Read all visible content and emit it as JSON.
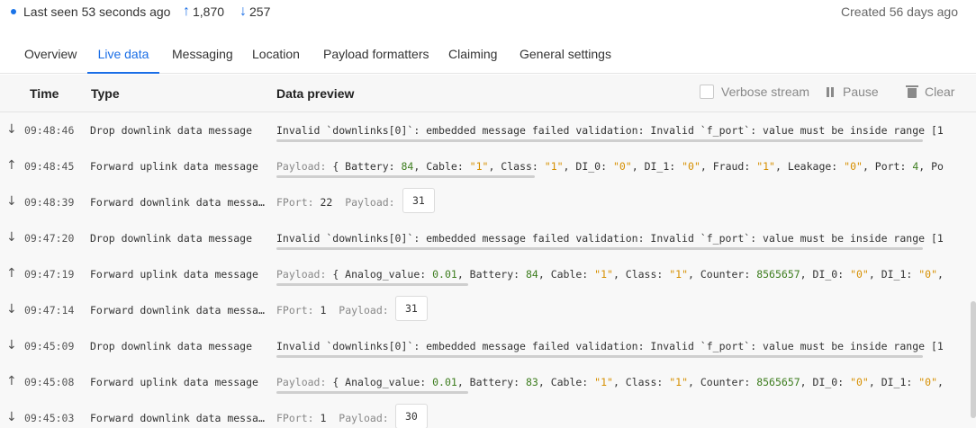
{
  "header": {
    "last_seen": "Last seen 53 seconds ago",
    "uplink_count": "1,870",
    "downlink_count": "257",
    "created": "Created 56 days ago"
  },
  "tabs": [
    "Overview",
    "Live data",
    "Messaging",
    "Location",
    "Payload formatters",
    "Claiming",
    "General settings"
  ],
  "active_tab": "Live data",
  "table": {
    "col_time": "Time",
    "col_type": "Type",
    "col_preview": "Data preview",
    "verbose_label": "Verbose stream",
    "pause_label": "Pause",
    "clear_label": "Clear"
  },
  "rows": [
    {
      "dir": "down",
      "time": "09:48:46",
      "type": "Drop downlink data message",
      "kind": "error",
      "text": "Invalid `downlinks[0]`: embedded message failed validation: Invalid `f_port`: value must be inside range [1"
    },
    {
      "dir": "up",
      "time": "09:48:45",
      "type": "Forward uplink data message",
      "kind": "payload",
      "label": "Payload:",
      "text_start": "{ Battery: ",
      "battery": "84",
      "text_rest": ", Cable: ",
      "cable": "\"1\"",
      "t2": ", Class: ",
      "class": "\"1\"",
      "t3": ", DI_0: ",
      "di0": "\"0\"",
      "t4": ", DI_1: ",
      "di1": "\"0\"",
      "t5": ", Fraud: ",
      "fraud": "\"1\"",
      "t6": ", Leakage: ",
      "leak": "\"0\"",
      "t7": ", Port: ",
      "port": "4",
      "t8": ", Po"
    },
    {
      "dir": "down",
      "time": "09:48:39",
      "type": "Forward downlink data message",
      "kind": "fport",
      "fport_label": "FPort:",
      "fport": "22",
      "payload_label": "Payload:",
      "payload": "31"
    },
    {
      "dir": "down",
      "time": "09:47:20",
      "type": "Drop downlink data message",
      "kind": "error",
      "text": "Invalid `downlinks[0]`: embedded message failed validation: Invalid `f_port`: value must be inside range [1"
    },
    {
      "dir": "up",
      "time": "09:47:19",
      "type": "Forward uplink data message",
      "kind": "payload2",
      "label": "Payload:",
      "t0": "{ Analog_value: ",
      "analog": "0.01",
      "t1": ", Battery: ",
      "battery": "84",
      "t2": ", Cable: ",
      "cable": "\"1\"",
      "t3": ", Class: ",
      "class": "\"1\"",
      "t4": ", Counter: ",
      "counter": "8565657",
      "t5": ", DI_0: ",
      "di0": "\"0\"",
      "t6": ", DI_1: ",
      "di1": "\"0\"",
      "t7": ","
    },
    {
      "dir": "down",
      "time": "09:47:14",
      "type": "Forward downlink data message",
      "kind": "fport",
      "fport_label": "FPort:",
      "fport": "1",
      "payload_label": "Payload:",
      "payload": "31"
    },
    {
      "dir": "down",
      "time": "09:45:09",
      "type": "Drop downlink data message",
      "kind": "error",
      "text": "Invalid `downlinks[0]`: embedded message failed validation: Invalid `f_port`: value must be inside range [1"
    },
    {
      "dir": "up",
      "time": "09:45:08",
      "type": "Forward uplink data message",
      "kind": "payload2",
      "label": "Payload:",
      "t0": "{ Analog_value: ",
      "analog": "0.01",
      "t1": ", Battery: ",
      "battery": "83",
      "t2": ", Cable: ",
      "cable": "\"1\"",
      "t3": ", Class: ",
      "class": "\"1\"",
      "t4": ", Counter: ",
      "counter": "8565657",
      "t5": ", DI_0: ",
      "di0": "\"0\"",
      "t6": ", DI_1: ",
      "di1": "\"0\"",
      "t7": ","
    },
    {
      "dir": "down",
      "time": "09:45:03",
      "type": "Forward downlink data message",
      "kind": "fport",
      "fport_label": "FPort:",
      "fport": "1",
      "payload_label": "Payload:",
      "payload": "30"
    }
  ],
  "colors": {
    "accent": "#1a6ee6",
    "number": "#3d7d1e",
    "string": "#d68f00"
  },
  "icons": {
    "up": "arrow-up-icon",
    "down": "arrow-down-icon",
    "pause": "pause-icon",
    "clear": "trash-icon"
  }
}
